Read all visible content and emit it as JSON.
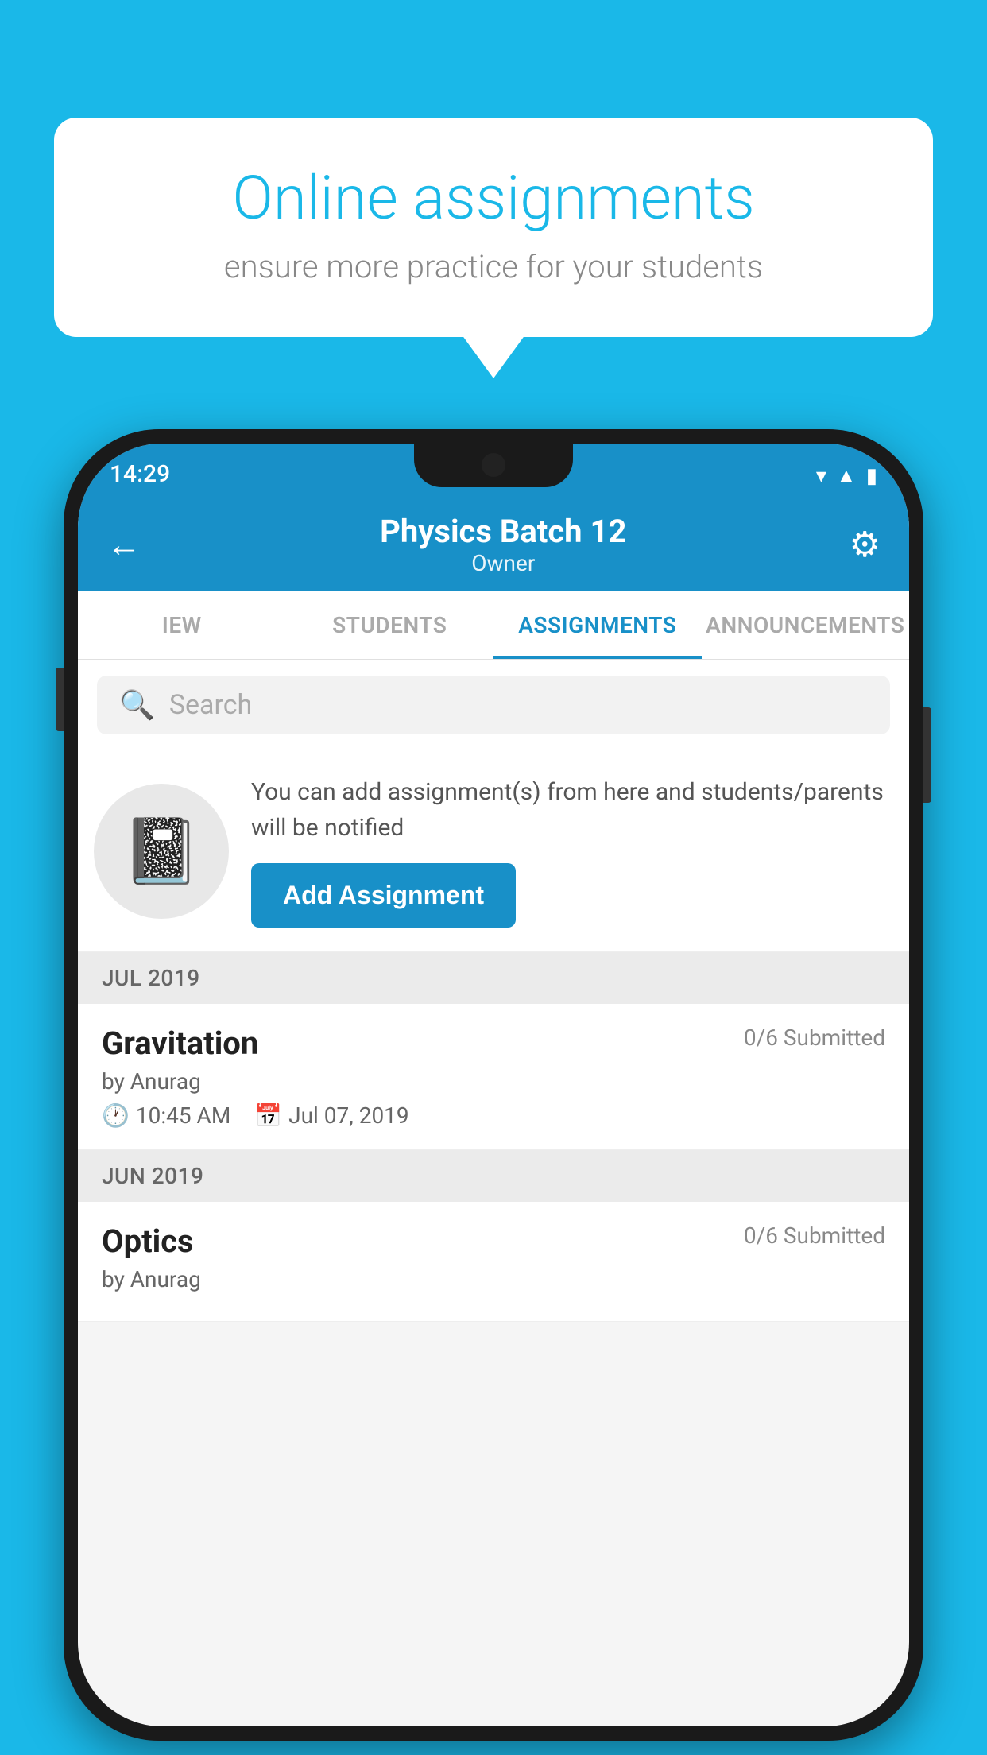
{
  "background_color": "#1ab8e8",
  "speech_bubble": {
    "title": "Online assignments",
    "subtitle": "ensure more practice for your students"
  },
  "status_bar": {
    "time": "14:29",
    "icons": [
      "wifi",
      "signal",
      "battery"
    ]
  },
  "app_bar": {
    "title": "Physics Batch 12",
    "subtitle": "Owner",
    "back_label": "←",
    "settings_label": "⚙"
  },
  "tabs": [
    {
      "label": "IEW",
      "active": false
    },
    {
      "label": "STUDENTS",
      "active": false
    },
    {
      "label": "ASSIGNMENTS",
      "active": true
    },
    {
      "label": "ANNOUNCEMENTS",
      "active": false
    }
  ],
  "search": {
    "placeholder": "Search"
  },
  "add_assignment_section": {
    "description": "You can add assignment(s) from here and students/parents will be notified",
    "button_label": "Add Assignment"
  },
  "sections": [
    {
      "month": "JUL 2019",
      "assignments": [
        {
          "name": "Gravitation",
          "submitted": "0/6 Submitted",
          "author": "by Anurag",
          "time": "10:45 AM",
          "date": "Jul 07, 2019"
        }
      ]
    },
    {
      "month": "JUN 2019",
      "assignments": [
        {
          "name": "Optics",
          "submitted": "0/6 Submitted",
          "author": "by Anurag",
          "time": "",
          "date": ""
        }
      ]
    }
  ]
}
